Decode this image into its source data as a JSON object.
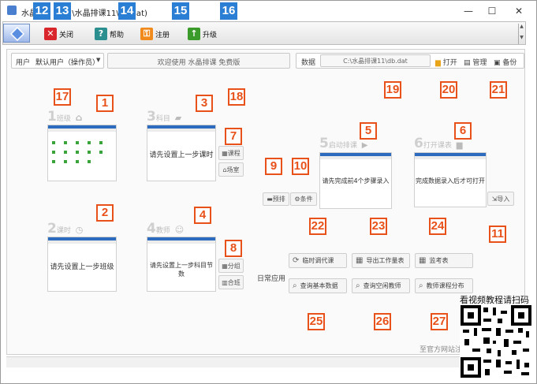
{
  "window": {
    "app_title": "水晶",
    "title_path": "(C:\\水晶排课11\\db.dat)",
    "min_glyph": "—",
    "max_glyph": "☐",
    "close_glyph": "✕"
  },
  "toolbar": {
    "close_label": "关闭",
    "help_label": "帮助",
    "register_label": "注册",
    "upgrade_label": "升级"
  },
  "user": {
    "label": "用户",
    "selected": "默认用户（操作员）"
  },
  "welcome": "欢迎使用 水晶排课 免费版",
  "database": {
    "label": "数据",
    "path": "C:\\水晶排课11\\db.dat",
    "open_label": "打开",
    "manage_label": "管理",
    "backup_label": "备份"
  },
  "steps": [
    {
      "num": "1",
      "name": "班级"
    },
    {
      "num": "2",
      "name": "课时",
      "message": "请先设置上一步班级"
    },
    {
      "num": "3",
      "name": "科目",
      "message": "请先设置上一步课时"
    },
    {
      "num": "4",
      "name": "教师",
      "message": "请先设置上一步科目节数"
    },
    {
      "num": "5",
      "name": "启动排课",
      "message": "请先完成前4个步骤录入"
    },
    {
      "num": "6",
      "name": "打开课表",
      "message": "完成数据录入后才可打开"
    }
  ],
  "side_buttons": {
    "course_label": "课程",
    "classroom_label": "场室",
    "group_label": "分组",
    "merge_label": "合班",
    "prearrange_label": "预排",
    "condition_label": "条件",
    "import_label": "导入"
  },
  "daily": {
    "label": "日常应用",
    "buttons": [
      "临时调代课",
      "导出工作量表",
      "监考表",
      "查询基本数据",
      "查询空闲教师",
      "教师课程分布"
    ]
  },
  "footer_link": "至官方网站注",
  "qr_caption": "看视频教程请扫码",
  "markers": [
    "1",
    "2",
    "3",
    "4",
    "5",
    "6",
    "7",
    "8",
    "9",
    "10",
    "11",
    "12",
    "13",
    "14",
    "15",
    "16",
    "17",
    "18",
    "19",
    "20",
    "21",
    "22",
    "23",
    "24",
    "25",
    "26",
    "27"
  ],
  "colors": {
    "marker": "#e8521a",
    "accent": "#2a7fd4",
    "close_red": "#d9262c",
    "help_teal": "#2b8f8f",
    "register_orange": "#f08a1c",
    "upgrade_green": "#3a9a2a"
  }
}
